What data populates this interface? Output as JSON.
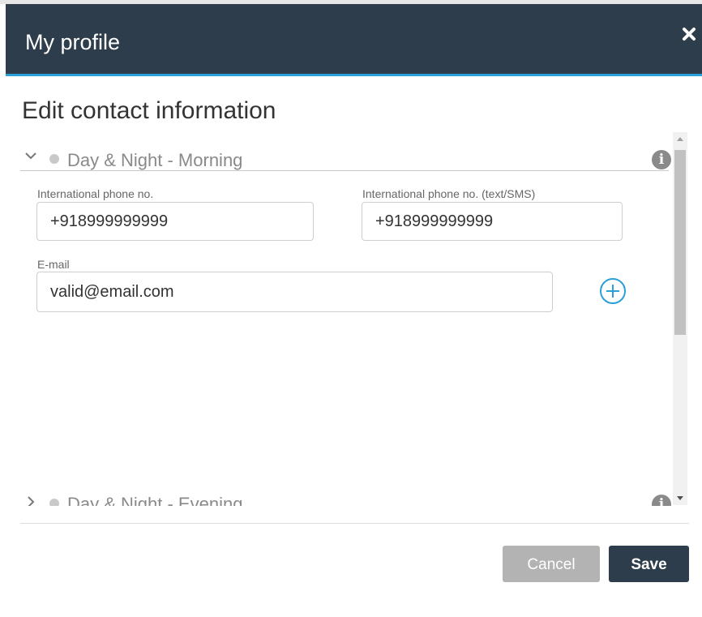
{
  "dialog": {
    "title": "My profile",
    "close_icon": "close-icon",
    "subtitle": "Edit contact information"
  },
  "sections": [
    {
      "label": "Day & Night - Morning",
      "expanded": true,
      "fields": {
        "intl_phone": {
          "label": "International phone no.",
          "value": "+918999999999"
        },
        "intl_phone_sms": {
          "label": "International phone no. (text/SMS)",
          "value": "+918999999999"
        },
        "email": {
          "label": "E-mail",
          "value": "valid@email.com"
        }
      },
      "add_icon": "plus-circle-icon",
      "info_icon": "info-icon"
    },
    {
      "label": "Day & Night - Evening",
      "expanded": false,
      "info_icon": "info-icon"
    }
  ],
  "footer": {
    "cancel_label": "Cancel",
    "save_label": "Save"
  },
  "colors": {
    "header_bg": "#2e3d4b",
    "accent": "#2a9fd8",
    "save_bg": "#2e3d4b",
    "cancel_bg": "#b3b3b3"
  }
}
